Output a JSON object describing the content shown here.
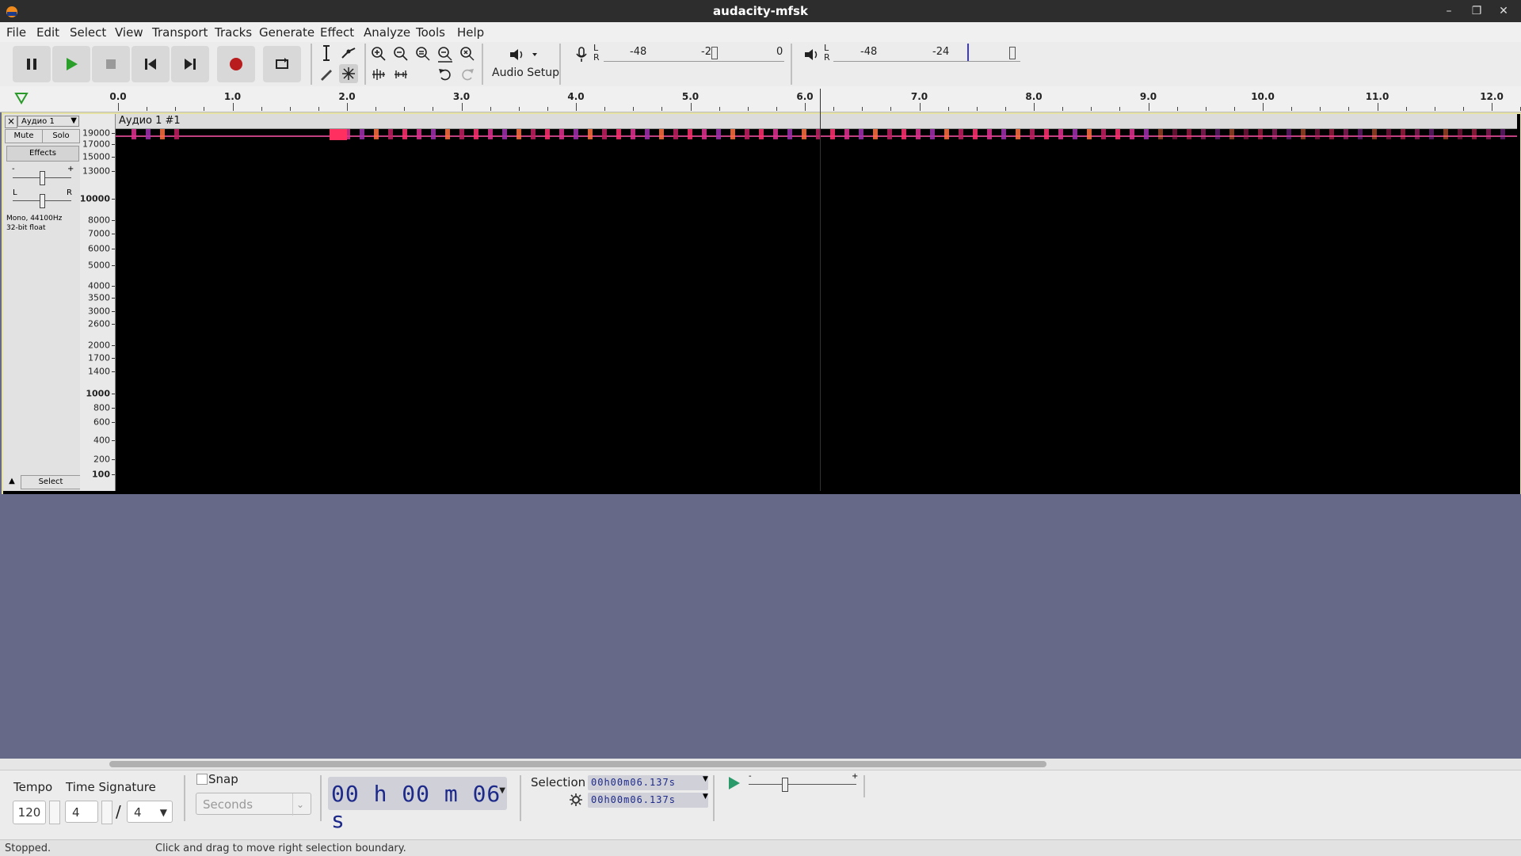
{
  "window": {
    "title": "audacity-mfsk"
  },
  "menu": [
    "File",
    "Edit",
    "Select",
    "View",
    "Transport",
    "Tracks",
    "Generate",
    "Effect",
    "Analyze",
    "Tools",
    "Help"
  ],
  "toolbar": {
    "audio_setup_label": "Audio Setup"
  },
  "meters": {
    "record": {
      "lr": "L R",
      "ticks": [
        "-48",
        "-2",
        "0"
      ]
    },
    "playback": {
      "lr": "L R",
      "ticks": [
        "-48",
        "-24"
      ]
    }
  },
  "ruler": {
    "labels": [
      "0.0",
      "1.0",
      "2.0",
      "3.0",
      "4.0",
      "5.0",
      "6.0",
      "7.0",
      "8.0",
      "9.0",
      "10.0",
      "11.0",
      "12.0"
    ]
  },
  "track": {
    "name": "Аудио 1",
    "close": "×",
    "mute": "Mute",
    "solo": "Solo",
    "effects": "Effects",
    "gain_minus": "-",
    "gain_plus": "+",
    "pan_left": "L",
    "pan_right": "R",
    "info_line1": "Mono, 44100Hz",
    "info_line2": "32-bit float",
    "select": "Select",
    "clip_name": "Аудио 1 #1"
  },
  "vruler": {
    "labels": [
      {
        "t": "19000",
        "b": false
      },
      {
        "t": "17000",
        "b": false
      },
      {
        "t": "15000",
        "b": false
      },
      {
        "t": "13000",
        "b": false
      },
      {
        "t": "10000",
        "b": true
      },
      {
        "t": "8000",
        "b": false
      },
      {
        "t": "7000",
        "b": false
      },
      {
        "t": "6000",
        "b": false
      },
      {
        "t": "5000",
        "b": false
      },
      {
        "t": "4000",
        "b": false
      },
      {
        "t": "3500",
        "b": false
      },
      {
        "t": "3000",
        "b": false
      },
      {
        "t": "2600",
        "b": false
      },
      {
        "t": "2000",
        "b": false
      },
      {
        "t": "1700",
        "b": false
      },
      {
        "t": "1400",
        "b": false
      },
      {
        "t": "1000",
        "b": true
      },
      {
        "t": "800",
        "b": false
      },
      {
        "t": "600",
        "b": false
      },
      {
        "t": "400",
        "b": false
      },
      {
        "t": "200",
        "b": false
      },
      {
        "t": "100",
        "b": true
      }
    ]
  },
  "bottom": {
    "tempo_label": "Tempo",
    "tempo_value": "120",
    "timesig_label": "Time Signature",
    "timesig_num": "4",
    "timesig_slash": "/",
    "timesig_den": "4",
    "snap_label": "Snap",
    "snap_unit": "Seconds",
    "time_display": "00 h 00 m 06 s",
    "selection_label": "Selection",
    "sel_start": "00h00m06.137s",
    "sel_end": "00h00m06.137s"
  },
  "status": {
    "left": "Stopped.",
    "right": "Click and drag to move right selection boundary."
  },
  "colors": {
    "accent_record": "#b81c1c",
    "play": "#2aa02a",
    "track_border": "#e6e2a4",
    "background": "#666a88"
  }
}
